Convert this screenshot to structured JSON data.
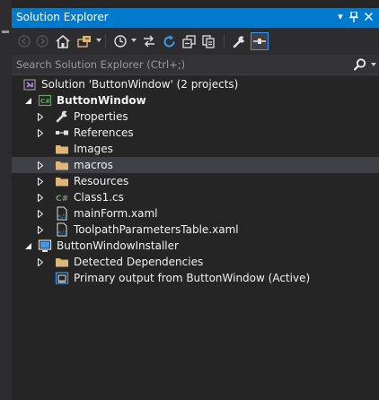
{
  "window": {
    "title": "Solution Explorer"
  },
  "search": {
    "placeholder": "Search Solution Explorer (Ctrl+;)"
  },
  "tree": {
    "solution": "Solution 'ButtonWindow' (2 projects)",
    "project1": "ButtonWindow",
    "properties": "Properties",
    "references": "References",
    "images": "Images",
    "macros": "macros",
    "resources": "Resources",
    "class1": "Class1.cs",
    "mainform": "mainForm.xaml",
    "toolpath": "ToolpathParametersTable.xaml",
    "project2": "ButtonWindowInstaller",
    "detected": "Detected Dependencies",
    "primary": "Primary output from ButtonWindow (Active)"
  },
  "colors": {
    "accent": "#007acc",
    "background": "#252526",
    "selection": "#3f3f46",
    "folder": "#dcb67a",
    "csharp": "#68a063"
  }
}
